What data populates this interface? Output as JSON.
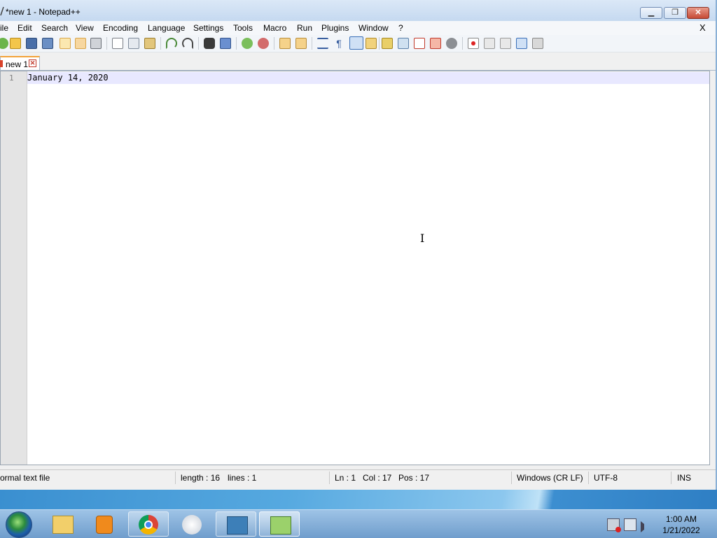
{
  "window": {
    "title": "*new 1 - Notepad++",
    "min_label": "▁",
    "max_label": "❐",
    "close_label": "✕"
  },
  "menu": {
    "items": [
      "ile",
      "Edit",
      "Search",
      "View",
      "Encoding",
      "Language",
      "Settings",
      "Tools",
      "Macro",
      "Run",
      "Plugins",
      "Window",
      "?"
    ],
    "close_label": "X"
  },
  "toolbar": {
    "icons": [
      "new-file",
      "open-file",
      "save",
      "save-all",
      "close",
      "close-all",
      "print",
      "cut",
      "copy",
      "paste",
      "undo",
      "redo",
      "find",
      "replace",
      "zoom-in",
      "zoom-out",
      "sync-vertical",
      "sync-horizontal",
      "word-wrap",
      "show-all-chars",
      "indent-guide",
      "function-list",
      "document-map",
      "folder-workspace",
      "monitoring",
      "doc-list",
      "hide-lines",
      "record-macro",
      "stop-recording",
      "playback-macro",
      "run-macro-multiple",
      "save-macro"
    ]
  },
  "tabs": [
    {
      "label": "new 1",
      "close_label": "✕"
    }
  ],
  "editor": {
    "line_number": "1",
    "line_text": "January 14, 2020",
    "cursor_glyph": "I"
  },
  "status": {
    "file_type": "ormal text file",
    "length": "length : 16",
    "lines": "lines : 1",
    "ln": "Ln : 1",
    "col": "Col : 17",
    "pos": "Pos : 17",
    "eol": "Windows (CR LF)",
    "encoding": "UTF-8",
    "mode": "INS"
  },
  "taskbar": {
    "apps": [
      "windows-explorer",
      "media-player",
      "chrome",
      "disc-app",
      "download-app",
      "notepad-plus-plus"
    ],
    "clock_time": "1:00 AM",
    "clock_date": "1/21/2022"
  },
  "colors": {
    "accent_tab": "#f3a33a",
    "current_line": "#e8e8ff",
    "gutter": "#e4e4e4",
    "taskbar": "#6f9dcc"
  }
}
